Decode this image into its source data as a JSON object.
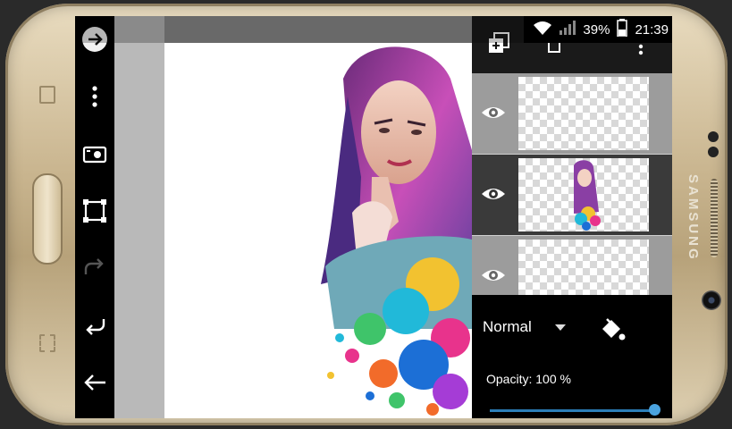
{
  "status": {
    "battery": "39%",
    "time": "21:39"
  },
  "device": {
    "brand": "SAMSUNG"
  },
  "toolbar": {
    "icons": [
      "arrow-right-icon",
      "more-vertical-icon",
      "video-camera-icon",
      "crop-icon",
      "redo-icon",
      "undo-icon",
      "back-arrow-icon"
    ]
  },
  "layers_panel": {
    "top_icons": [
      "add-layer-icon",
      "delete-layer-icon",
      "more-vertical-icon"
    ],
    "layers": [
      {
        "visible": true,
        "active": false
      },
      {
        "visible": true,
        "active": true
      },
      {
        "visible": true,
        "active": false
      }
    ],
    "blend_mode": "Normal",
    "opacity_label": "Opacity: 100 %",
    "opacity_value": 1.0
  },
  "colors": {
    "accent": "#4aa3df"
  }
}
